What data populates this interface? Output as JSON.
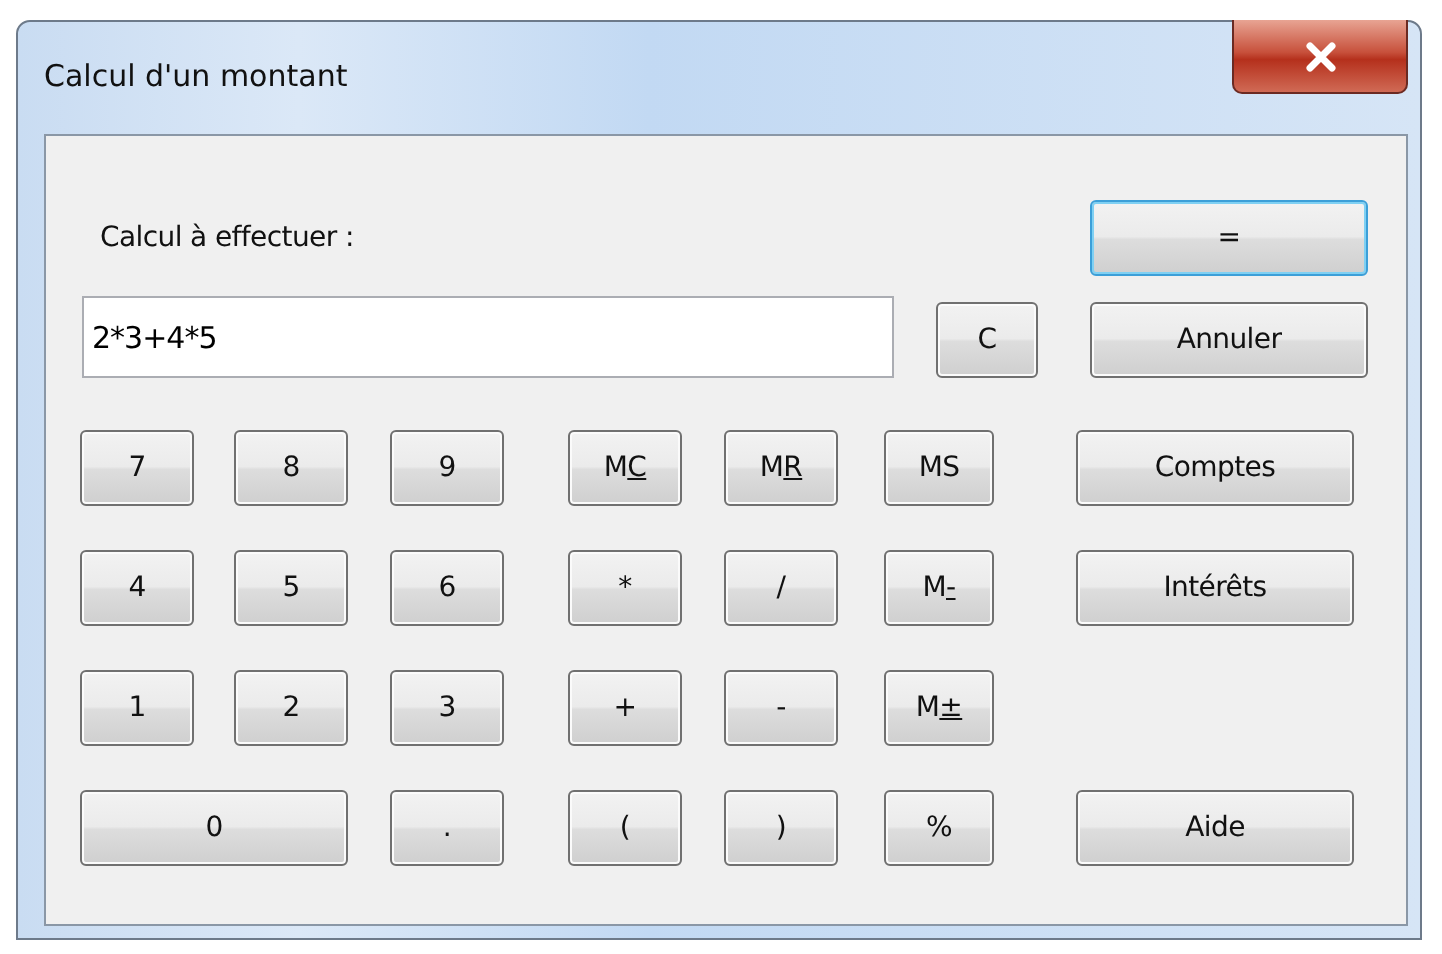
{
  "window": {
    "title": "Calcul d'un montant"
  },
  "form": {
    "label": "Calcul à effectuer :",
    "value": "2*3+4*5",
    "clear_button": "C"
  },
  "side_buttons": [
    {
      "label": "=",
      "default": true
    },
    {
      "label": "Annuler",
      "default": false
    }
  ],
  "keypad": [
    {
      "keys": [
        {
          "label": "7",
          "kind": "key"
        },
        {
          "label": "8",
          "kind": "key"
        },
        {
          "label": "9",
          "kind": "key"
        },
        {
          "label": "M",
          "access_key": "C",
          "kind": "key"
        },
        {
          "label": "M",
          "access_key": "R",
          "kind": "key"
        },
        {
          "label": "MS",
          "kind": "key"
        }
      ],
      "side": {
        "label": "Comptes"
      }
    },
    {
      "keys": [
        {
          "label": "4",
          "kind": "key"
        },
        {
          "label": "5",
          "kind": "key"
        },
        {
          "label": "6",
          "kind": "key"
        },
        {
          "label": "*",
          "kind": "key"
        },
        {
          "label": "/",
          "kind": "key"
        },
        {
          "label": "M",
          "access_key": "-",
          "kind": "key"
        }
      ],
      "side": {
        "label": "Intérêts"
      }
    },
    {
      "keys": [
        {
          "label": "1",
          "kind": "key"
        },
        {
          "label": "2",
          "kind": "key"
        },
        {
          "label": "3",
          "kind": "key"
        },
        {
          "label": "+",
          "kind": "key"
        },
        {
          "label": "-",
          "kind": "key"
        },
        {
          "label": "M",
          "access_key": "±",
          "kind": "key"
        }
      ]
    },
    {
      "keys": [
        {
          "label": "0",
          "kind": "wide"
        },
        {
          "label": ".",
          "kind": "key"
        },
        {
          "label": "(",
          "kind": "key"
        },
        {
          "label": ")",
          "kind": "key"
        },
        {
          "label": "%",
          "kind": "key"
        }
      ],
      "side": {
        "label": "Aide"
      }
    }
  ]
}
